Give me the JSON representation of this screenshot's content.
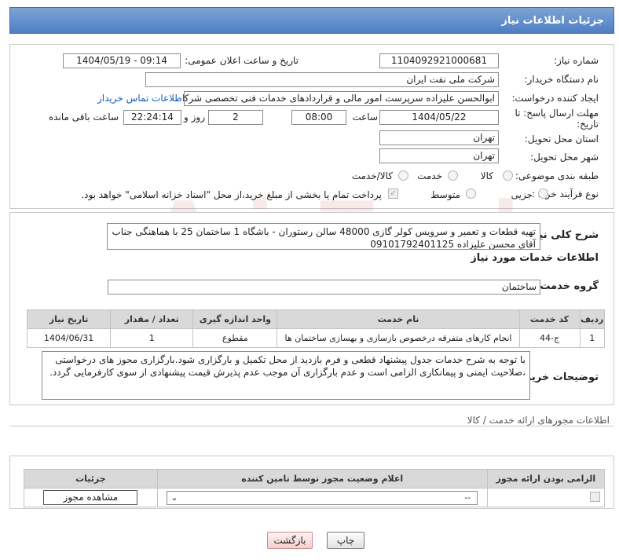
{
  "header": {
    "title": "جزئیات اطلاعات نیاز"
  },
  "form": {
    "need_number_label": "شماره نیاز:",
    "need_number": "1104092921000681",
    "announce_label": "تاریخ و ساعت اعلان عمومی:",
    "announce_value": "1404/05/19 - 09:14",
    "buyer_label": "نام دستگاه خریدار:",
    "buyer_value": "شرکت ملی نفت ایران",
    "creator_label": "ایجاد کننده درخواست:",
    "creator_value": "ابوالحسن علیزاده سرپرست امور مالی و قراردادهای خدمات فنی تخصصی شرکت",
    "contact_link": "اطلاعات تماس خریدار",
    "deadline_label_1": "مهلت ارسال پاسخ: تا",
    "deadline_label_2": "تاریخ:",
    "deadline_date": "1404/05/22",
    "time_label": "ساعت",
    "deadline_time": "08:00",
    "days_value": "2",
    "days_label": "روز و",
    "remaining_value": "22:24:14",
    "remaining_label": "ساعت باقی مانده",
    "province_label": "استان محل تحویل:",
    "province_value": "تهران",
    "city_label": "شهر محل تحویل:",
    "city_value": "تهران",
    "category_label": "طبقه بندی موضوعی:",
    "category_options": [
      "کالا",
      "خدمت",
      "کالا/خدمت"
    ],
    "process_label": "نوع فرآیند خرید :",
    "process_options": [
      "جزیی",
      "متوسط"
    ],
    "payment_note": "پرداخت تمام یا بخشی از مبلغ خرید،از محل \"اسناد خزانه اسلامی\" خواهد بود."
  },
  "summary": {
    "label": "شرح کلی نیاز:",
    "text": "تهیه  قطعات و تعمیر و سرویس کولر گازی 48000 سالن رستوران - باشگاه 1 ساختمان 25 با هماهنگی جناب آقای محسن علیزاده 09101792401125",
    "services_title": "اطلاعات خدمات مورد نیاز",
    "group_label": "گروه خدمت:",
    "group_value": "ساختمان"
  },
  "services_table": {
    "headers": [
      "ردیف",
      "کد خدمت",
      "نام خدمت",
      "واحد اندازه گیری",
      "تعداد / مقدار",
      "تاریخ نیاز"
    ],
    "rows": [
      [
        "1",
        "ج-44",
        "انجام کارهای متفرقه درخصوص بازسازی و بهسازی ساختمان ها",
        "مقطوع",
        "1",
        "1404/06/31"
      ]
    ]
  },
  "buyer_notes": {
    "label": "توضیحات خریدار:",
    "text": "با توجه به شرح خدمات جدول پیشنهاد قطعی و فرم بازدید از محل تکمیل و بارگزاری شود.بارگزاری مجوز های درخواستی ،صلاحیت ایمنی و پیمانکاری الزامی است و عدم بارگزاری آن موجب عدم پذیرش قیمت پیشنهادی  از سوی کارفرمایی گردد."
  },
  "permits": {
    "title": "اطلاعات مجوزهای ارائه خدمت / کالا",
    "headers": [
      "الزامی بودن ارائه مجوز",
      "اعلام وضعیت مجوز توسط تامین کننده",
      "جزئیات"
    ],
    "select_value": "--",
    "view_button": "مشاهده مجوز"
  },
  "footer": {
    "print_button": "چاپ",
    "back_button": "بازگشت"
  },
  "watermark": "AriaTender.net"
}
